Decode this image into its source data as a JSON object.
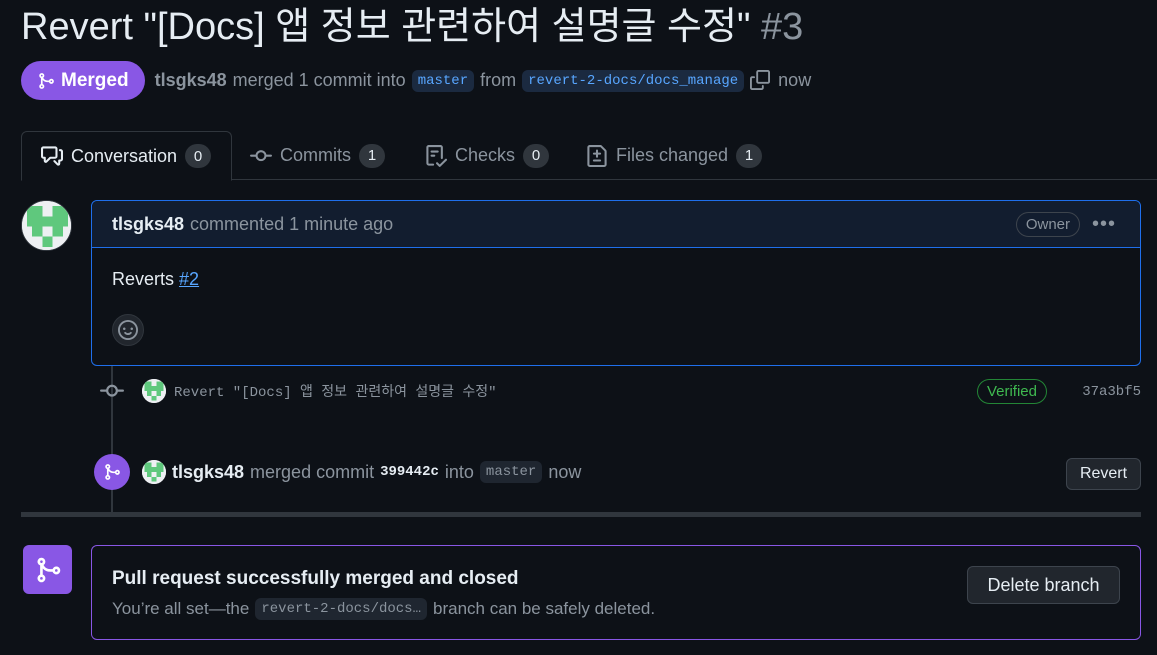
{
  "pr": {
    "title": "Revert \"[Docs] 앱 정보 관련하여 설명글 수정\"",
    "number": "#3",
    "state": "Merged",
    "author": "tlsgks48",
    "merged_text": "merged 1 commit into",
    "base_branch": "master",
    "from_text": "from",
    "head_branch": "revert-2-docs/docs_manage",
    "time": "now"
  },
  "tabs": [
    {
      "label": "Conversation",
      "count": "0",
      "icon": "comment-discussion-icon"
    },
    {
      "label": "Commits",
      "count": "1",
      "icon": "git-commit-icon"
    },
    {
      "label": "Checks",
      "count": "0",
      "icon": "checklist-icon"
    },
    {
      "label": "Files changed",
      "count": "1",
      "icon": "file-diff-icon"
    }
  ],
  "comment": {
    "author": "tlsgks48",
    "action": "commented 1 minute ago",
    "role": "Owner",
    "body_prefix": "Reverts",
    "body_link": "#2"
  },
  "commit": {
    "message": "Revert \"[Docs] 앱 정보 관련하여 설명글 수정\"",
    "verified": "Verified",
    "sha": "37a3bf5"
  },
  "merge_event": {
    "author": "tlsgks48",
    "text": "merged commit",
    "sha": "399442c",
    "into_text": "into",
    "branch": "master",
    "time": "now",
    "revert_label": "Revert"
  },
  "merged_box": {
    "title": "Pull request successfully merged and closed",
    "sub_prefix": "You’re all set—the",
    "branch": "revert-2-docs/docs…",
    "sub_suffix": "branch can be safely deleted.",
    "delete_label": "Delete branch"
  },
  "colors": {
    "merged_purple": "#8957e5",
    "link_blue": "#58a6ff",
    "verified_green": "#3fb950",
    "background": "#0d1117"
  }
}
